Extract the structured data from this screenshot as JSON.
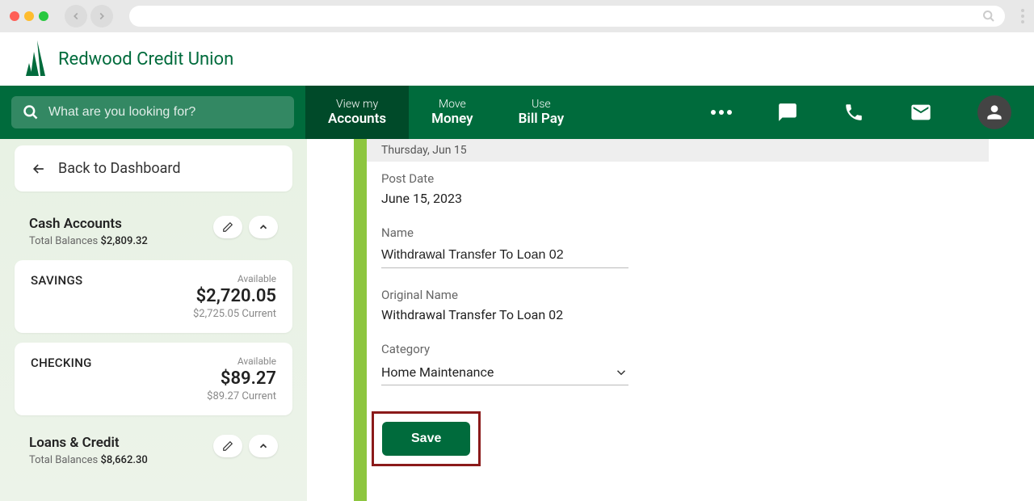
{
  "browser": {
    "search_placeholder": ""
  },
  "logo": {
    "text": "Redwood Credit Union"
  },
  "nav": {
    "search_placeholder": "What are you looking for?",
    "tabs": [
      {
        "top": "View my",
        "bottom": "Accounts"
      },
      {
        "top": "Move",
        "bottom": "Money"
      },
      {
        "top": "Use",
        "bottom": "Bill Pay"
      }
    ]
  },
  "sidebar": {
    "back_label": "Back to Dashboard",
    "sections": [
      {
        "title": "Cash Accounts",
        "sub_label": "Total Balances",
        "sub_amount": "$2,809.32",
        "accounts": [
          {
            "name": "SAVINGS",
            "avail_label": "Available",
            "avail_amount": "$2,720.05",
            "current": "$2,725.05 Current"
          },
          {
            "name": "CHECKING",
            "avail_label": "Available",
            "avail_amount": "$89.27",
            "current": "$89.27 Current"
          }
        ]
      },
      {
        "title": "Loans & Credit",
        "sub_label": "Total Balances",
        "sub_amount": "$8,662.30"
      }
    ]
  },
  "detail": {
    "date_header": "Thursday, Jun 15",
    "post_date_label": "Post Date",
    "post_date_value": "June 15, 2023",
    "name_label": "Name",
    "name_value": "Withdrawal Transfer To Loan 02",
    "original_name_label": "Original Name",
    "original_name_value": "Withdrawal Transfer To Loan 02",
    "category_label": "Category",
    "category_value": "Home Maintenance",
    "save_label": "Save"
  }
}
